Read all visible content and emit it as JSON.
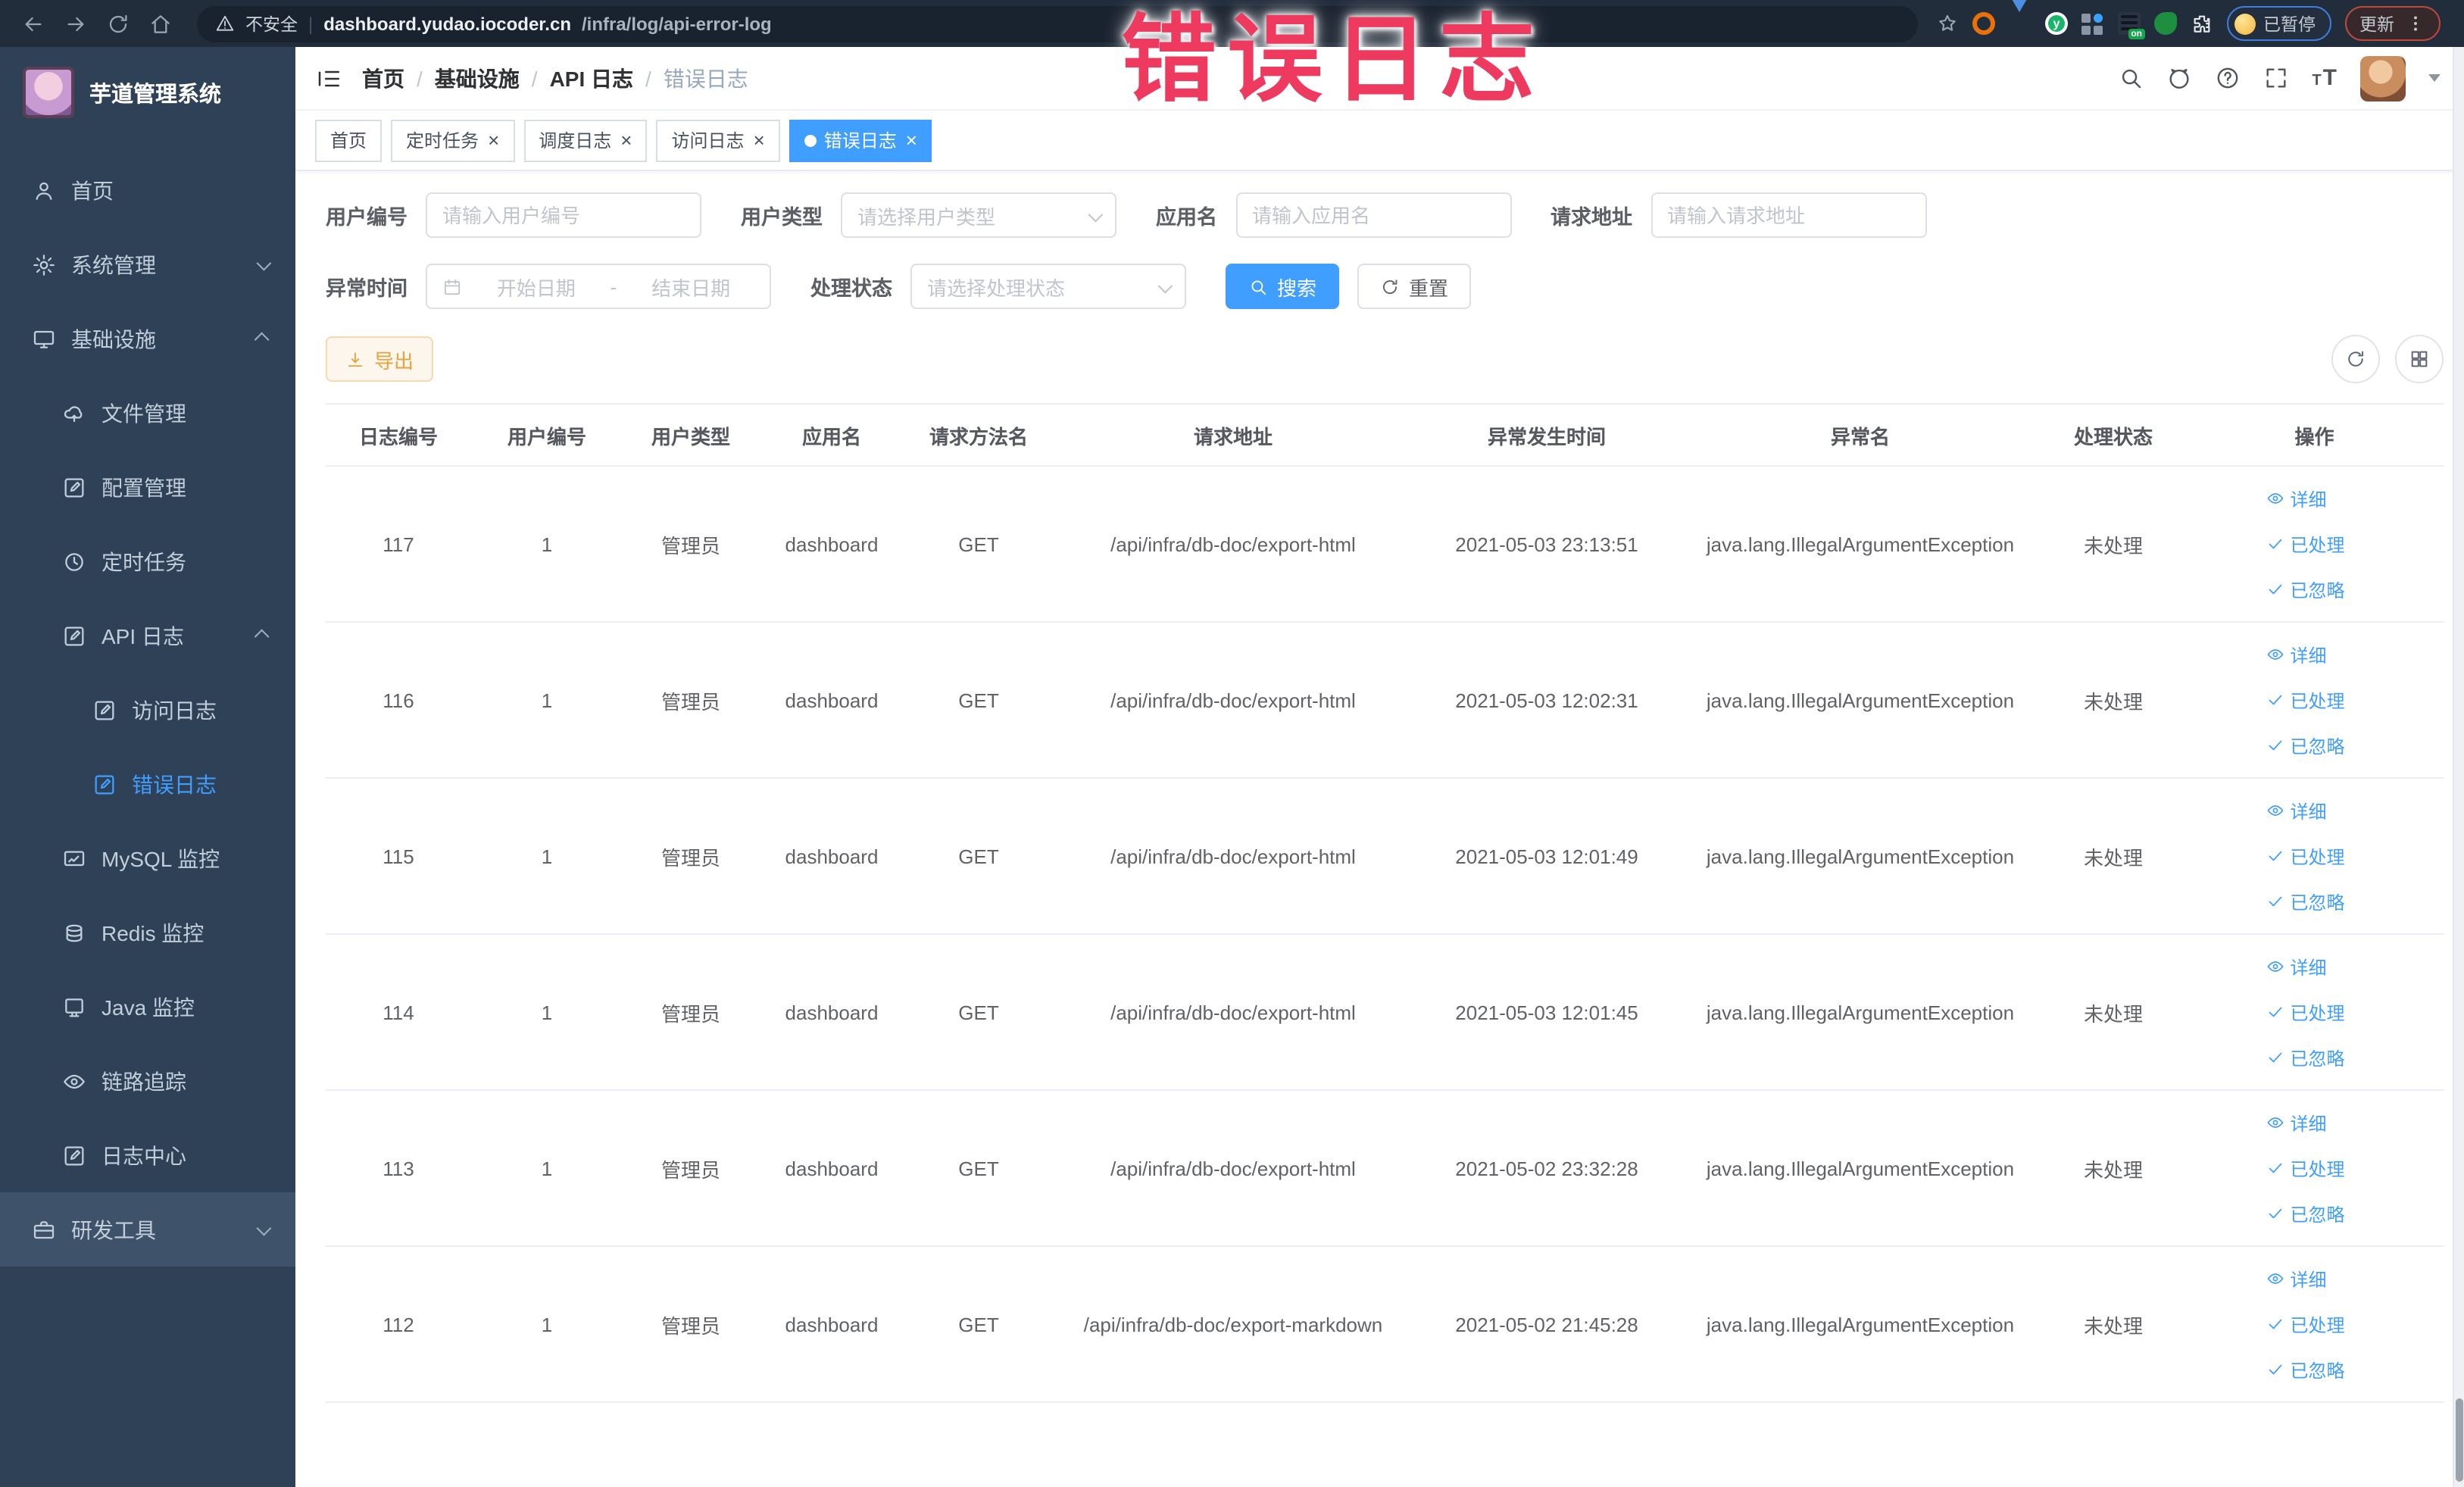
{
  "browser": {
    "security_label": "不安全",
    "url_host": "dashboard.yudao.iocoder.cn",
    "url_path": "/infra/log/api-error-log",
    "paused_badge": "已暂停",
    "update_button": "更新",
    "ext_on_badge": "on",
    "menu_dots": "⋮"
  },
  "annotation": {
    "text": "错误日志",
    "color": "#ee3a5e"
  },
  "sidebar": {
    "app_title": "芋道管理系统",
    "items": [
      {
        "label": "首页"
      },
      {
        "label": "系统管理"
      },
      {
        "label": "基础设施"
      },
      {
        "label": "文件管理"
      },
      {
        "label": "配置管理"
      },
      {
        "label": "定时任务"
      },
      {
        "label": "API 日志"
      },
      {
        "label": "访问日志"
      },
      {
        "label": "错误日志"
      },
      {
        "label": "MySQL 监控"
      },
      {
        "label": "Redis 监控"
      },
      {
        "label": "Java 监控"
      },
      {
        "label": "链路追踪"
      },
      {
        "label": "日志中心"
      },
      {
        "label": "研发工具"
      }
    ]
  },
  "header": {
    "breadcrumb": [
      "首页",
      "基础设施",
      "API 日志",
      "错误日志"
    ],
    "separator": "/"
  },
  "tabs": [
    {
      "label": "首页"
    },
    {
      "label": "定时任务"
    },
    {
      "label": "调度日志"
    },
    {
      "label": "访问日志"
    },
    {
      "label": "错误日志"
    }
  ],
  "ui": {
    "close_glyph": "×",
    "range_separator": "-"
  },
  "filters": {
    "user_id": {
      "label": "用户编号",
      "placeholder": "请输入用户编号"
    },
    "user_type": {
      "label": "用户类型",
      "placeholder": "请选择用户类型"
    },
    "app_name": {
      "label": "应用名",
      "placeholder": "请输入应用名"
    },
    "request_url": {
      "label": "请求地址",
      "placeholder": "请输入请求地址"
    },
    "exception_time": {
      "label": "异常时间",
      "start_placeholder": "开始日期",
      "end_placeholder": "结束日期"
    },
    "process_status": {
      "label": "处理状态",
      "placeholder": "请选择处理状态"
    },
    "search_button": "搜索",
    "reset_button": "重置"
  },
  "toolbar": {
    "export_button": "导出"
  },
  "table": {
    "headers": [
      "日志编号",
      "用户编号",
      "用户类型",
      "应用名",
      "请求方法名",
      "请求地址",
      "异常发生时间",
      "异常名",
      "处理状态",
      "操作"
    ],
    "rows": [
      {
        "id": "117",
        "user_id": "1",
        "user_type": "管理员",
        "app": "dashboard",
        "method": "GET",
        "url": "/api/infra/db-doc/export-html",
        "time": "2021-05-03 23:13:51",
        "exception": "java.lang.IllegalArgumentException",
        "status": "未处理"
      },
      {
        "id": "116",
        "user_id": "1",
        "user_type": "管理员",
        "app": "dashboard",
        "method": "GET",
        "url": "/api/infra/db-doc/export-html",
        "time": "2021-05-03 12:02:31",
        "exception": "java.lang.IllegalArgumentException",
        "status": "未处理"
      },
      {
        "id": "115",
        "user_id": "1",
        "user_type": "管理员",
        "app": "dashboard",
        "method": "GET",
        "url": "/api/infra/db-doc/export-html",
        "time": "2021-05-03 12:01:49",
        "exception": "java.lang.IllegalArgumentException",
        "status": "未处理"
      },
      {
        "id": "114",
        "user_id": "1",
        "user_type": "管理员",
        "app": "dashboard",
        "method": "GET",
        "url": "/api/infra/db-doc/export-html",
        "time": "2021-05-03 12:01:45",
        "exception": "java.lang.IllegalArgumentException",
        "status": "未处理"
      },
      {
        "id": "113",
        "user_id": "1",
        "user_type": "管理员",
        "app": "dashboard",
        "method": "GET",
        "url": "/api/infra/db-doc/export-html",
        "time": "2021-05-02 23:32:28",
        "exception": "java.lang.IllegalArgumentException",
        "status": "未处理"
      },
      {
        "id": "112",
        "user_id": "1",
        "user_type": "管理员",
        "app": "dashboard",
        "method": "GET",
        "url": "/api/infra/db-doc/export-markdown",
        "time": "2021-05-02 21:45:28",
        "exception": "java.lang.IllegalArgumentException",
        "status": "未处理"
      }
    ],
    "actions": [
      "详细",
      "已处理",
      "已忽略"
    ]
  }
}
